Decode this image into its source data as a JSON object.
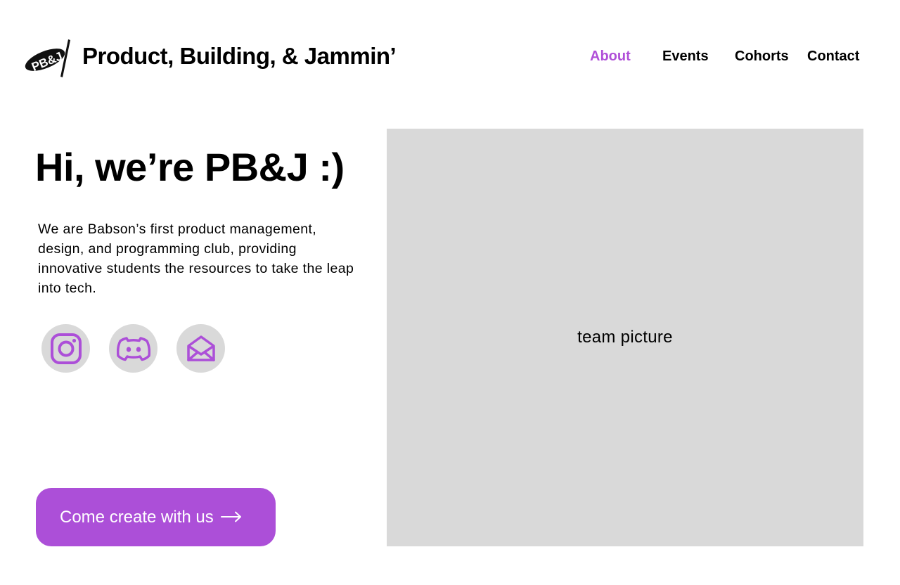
{
  "header": {
    "logo_text": "PB&J",
    "title": "Product, Building, & Jammin’"
  },
  "nav": {
    "items": [
      {
        "label": "About",
        "active": true
      },
      {
        "label": "Events",
        "active": false
      },
      {
        "label": "Cohorts",
        "active": false
      },
      {
        "label": "Contact",
        "active": false
      }
    ]
  },
  "hero": {
    "title": "Hi, we’re PB&J :)",
    "description": "We are Babson’s first product management, design, and programming club, providing innovative students the resources to take the leap into tech.",
    "cta_label": "Come create with us"
  },
  "social": {
    "icons": [
      "instagram-icon",
      "discord-icon",
      "mail-icon"
    ]
  },
  "media": {
    "placeholder_text": "team picture"
  },
  "colors": {
    "accent": "#ac4fd8",
    "placeholder_bg": "#d9d9d9",
    "text": "#000000"
  }
}
